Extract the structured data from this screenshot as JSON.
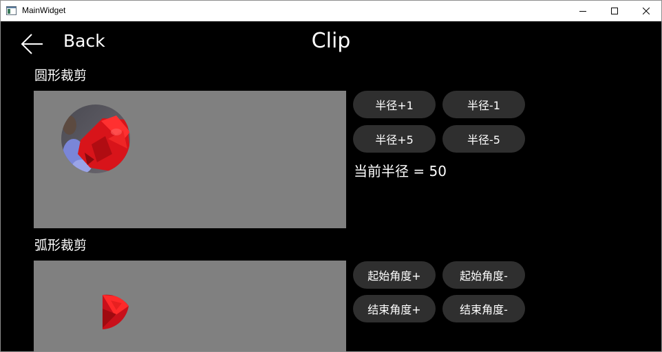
{
  "window": {
    "title": "MainWidget",
    "icon": "app-window-icon",
    "controls": [
      "minimize-icon",
      "maximize-icon",
      "close-icon"
    ]
  },
  "header": {
    "back_label": "Back",
    "back_icon": "arrow-left-icon",
    "title": "Clip"
  },
  "circle_clip": {
    "title": "圆形裁剪",
    "buttons": {
      "radius_plus_1": "半径+1",
      "radius_minus_1": "半径-1",
      "radius_plus_5": "半径+5",
      "radius_minus_5": "半径-5"
    },
    "readout": "当前半径 = 50"
  },
  "arc_clip": {
    "title": "弧形裁剪",
    "buttons": {
      "start_angle_plus": "起始角度+",
      "start_angle_minus": "起始角度-",
      "end_angle_plus": "结束角度+",
      "end_angle_minus": "结束角度-"
    }
  },
  "colors": {
    "background": "#000000",
    "canvas": "#808080",
    "button_bg": "#2f2f2f",
    "text": "#ffffff",
    "flower": "#e01818"
  }
}
